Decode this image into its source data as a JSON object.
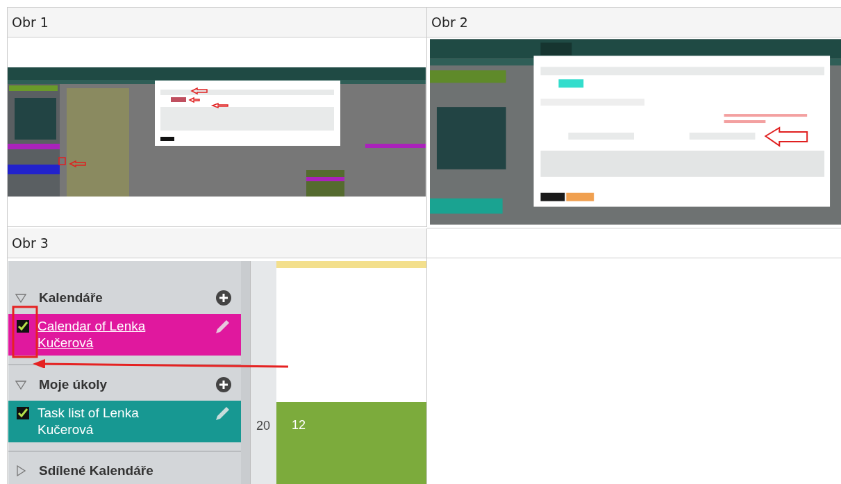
{
  "table": {
    "rows": [
      {
        "kind": "header",
        "cells": [
          "Obr 1",
          "Obr 2"
        ]
      },
      {
        "kind": "thumbs"
      },
      {
        "kind": "header",
        "cells": [
          "Obr 3"
        ]
      },
      {
        "kind": "detail"
      }
    ]
  },
  "detail": {
    "sections": [
      {
        "title": "Kalendáře",
        "expanded": true,
        "items": [
          {
            "label": "Calendar of Lenka Kučerová",
            "link": true,
            "checked": true,
            "color": "#e0189e"
          }
        ]
      },
      {
        "title": "Moje úkoly",
        "expanded": true,
        "items": [
          {
            "label": "Task list of Lenka Kučerová",
            "link": false,
            "checked": true,
            "color": "#179892"
          }
        ]
      },
      {
        "title": "Sdílené Kalendáře",
        "expanded": false
      }
    ],
    "week_number": "20",
    "day_number": "12"
  }
}
